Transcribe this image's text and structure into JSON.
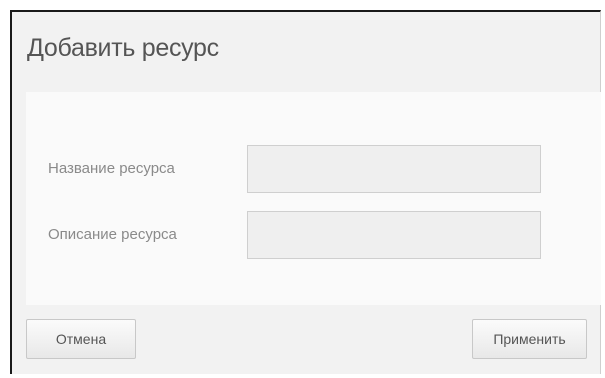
{
  "dialog": {
    "title": "Добавить ресурс",
    "fields": {
      "name": {
        "label": "Название ресурса",
        "value": "",
        "placeholder": ""
      },
      "description": {
        "label": "Описание ресурса",
        "value": "",
        "placeholder": ""
      }
    },
    "buttons": {
      "cancel_label": "Отмена",
      "apply_label": "Применить"
    }
  }
}
